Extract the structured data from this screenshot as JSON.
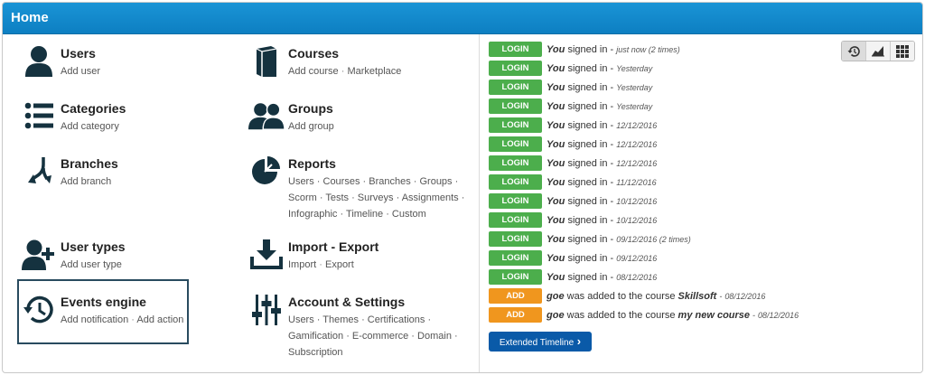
{
  "header": {
    "title": "Home"
  },
  "menu": [
    {
      "title": "Users",
      "links": [
        "Add user"
      ]
    },
    {
      "title": "Categories",
      "links": [
        "Add category"
      ]
    },
    {
      "title": "Branches",
      "links": [
        "Add branch"
      ]
    },
    {
      "title": "User types",
      "links": [
        "Add user type"
      ]
    },
    {
      "title": "Events engine",
      "links": [
        "Add notification",
        "Add action"
      ]
    },
    {
      "title": "Courses",
      "links": [
        "Add course",
        "Marketplace"
      ]
    },
    {
      "title": "Groups",
      "links": [
        "Add group"
      ]
    },
    {
      "title": "Reports",
      "lines": [
        "Users · Courses · Branches · Groups ·",
        "Scorm · Tests · Surveys · Assignments ·",
        "Infographic · Timeline · Custom"
      ]
    },
    {
      "title": "Import - Export",
      "links": [
        "Import",
        "Export"
      ]
    },
    {
      "title": "Account & Settings",
      "lines": [
        "Users · Themes · Certifications ·",
        "Gamification · E-commerce · Domain ·",
        "Subscription"
      ]
    }
  ],
  "timeline": {
    "events": [
      {
        "badge": "LOGIN",
        "actor": "You",
        "text": "signed in -",
        "time": "just now (2 times)"
      },
      {
        "badge": "LOGIN",
        "actor": "You",
        "text": "signed in -",
        "time": "Yesterday"
      },
      {
        "badge": "LOGIN",
        "actor": "You",
        "text": "signed in -",
        "time": "Yesterday"
      },
      {
        "badge": "LOGIN",
        "actor": "You",
        "text": "signed in -",
        "time": "Yesterday"
      },
      {
        "badge": "LOGIN",
        "actor": "You",
        "text": "signed in -",
        "time": "12/12/2016"
      },
      {
        "badge": "LOGIN",
        "actor": "You",
        "text": "signed in -",
        "time": "12/12/2016"
      },
      {
        "badge": "LOGIN",
        "actor": "You",
        "text": "signed in -",
        "time": "12/12/2016"
      },
      {
        "badge": "LOGIN",
        "actor": "You",
        "text": "signed in -",
        "time": "11/12/2016"
      },
      {
        "badge": "LOGIN",
        "actor": "You",
        "text": "signed in -",
        "time": "10/12/2016"
      },
      {
        "badge": "LOGIN",
        "actor": "You",
        "text": "signed in -",
        "time": "10/12/2016"
      },
      {
        "badge": "LOGIN",
        "actor": "You",
        "text": "signed in -",
        "time": "09/12/2016 (2 times)"
      },
      {
        "badge": "LOGIN",
        "actor": "You",
        "text": "signed in -",
        "time": "09/12/2016"
      },
      {
        "badge": "LOGIN",
        "actor": "You",
        "text": "signed in -",
        "time": "08/12/2016"
      },
      {
        "badge": "ADD",
        "actor": "goe",
        "text": "was added to the course",
        "course": "Skillsoft",
        "time": "08/12/2016"
      },
      {
        "badge": "ADD",
        "actor": "goe",
        "text": "was added to the course",
        "course": "my new course",
        "time": "08/12/2016"
      }
    ],
    "extended_button": "Extended Timeline"
  },
  "view_switch": [
    "history-icon",
    "area-chart-icon",
    "grid-icon"
  ],
  "colors": {
    "header": "#1a94d6",
    "login": "#4cae4c",
    "add": "#f0961e",
    "button": "#0a5aa8",
    "icon": "#15323f"
  }
}
